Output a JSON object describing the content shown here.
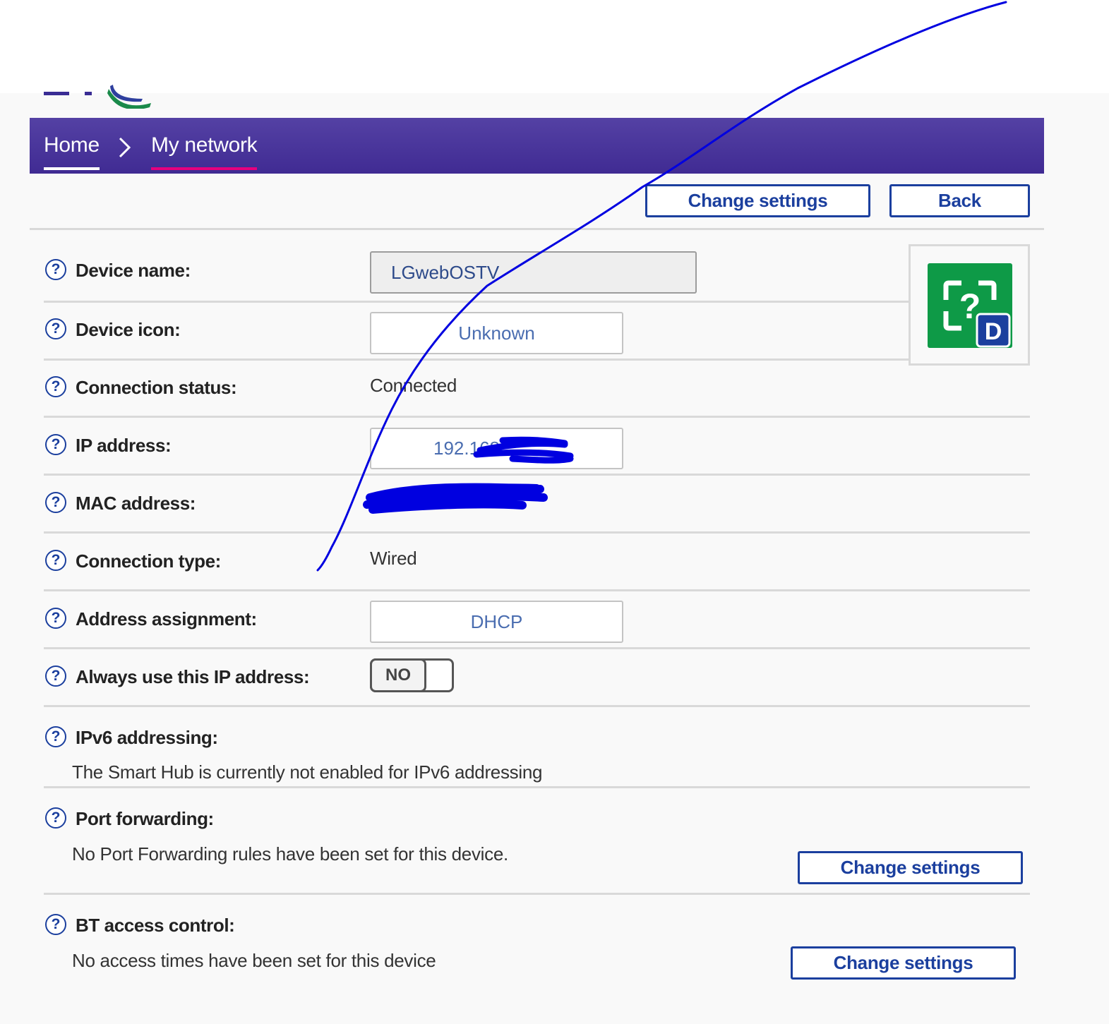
{
  "nav": {
    "home_label": "Home",
    "current_label": "My network"
  },
  "toolbar": {
    "change_settings_label": "Change settings",
    "back_label": "Back"
  },
  "help_glyph": "?",
  "rows": {
    "device_name": {
      "label": "Device name:",
      "value": "LGwebOSTV"
    },
    "device_icon": {
      "label": "Device icon:",
      "value": "Unknown"
    },
    "connection_status": {
      "label": "Connection status:",
      "value": "Connected"
    },
    "ip_address": {
      "label": "IP address:",
      "value": "192.168"
    },
    "mac_address": {
      "label": "MAC address:",
      "value": ""
    },
    "connection_type": {
      "label": "Connection type:",
      "value": "Wired"
    },
    "address_assignment": {
      "label": "Address assignment:",
      "value": "DHCP"
    },
    "always_use_ip": {
      "label": "Always use this IP address:",
      "toggle": "NO"
    }
  },
  "sections": {
    "ipv6": {
      "label": "IPv6 addressing:",
      "text": "The Smart Hub is currently not enabled for IPv6 addressing"
    },
    "port_forwarding": {
      "label": "Port forwarding:",
      "text": "No Port Forwarding rules have been set for this device.",
      "button": "Change settings"
    },
    "access_control": {
      "label": "BT access control:",
      "text": "No access times have been set for this device",
      "button": "Change settings"
    }
  },
  "device_icon_image": {
    "icon": "unknown-device-icon",
    "badge": "D",
    "bg_color": "#0e9a47",
    "badge_color": "#1b3f9e"
  },
  "colors": {
    "nav_bg": "#4a37a0",
    "accent": "#1b3f9e",
    "nav_underline": "#e6007e",
    "annotation": "#0000e0"
  }
}
